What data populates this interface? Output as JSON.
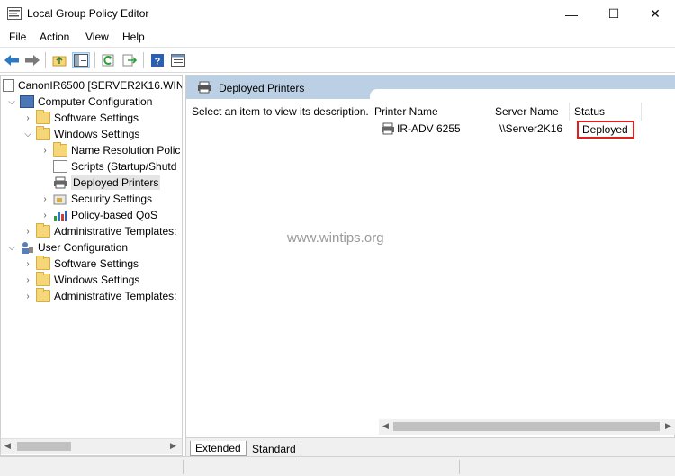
{
  "window": {
    "title": "Local Group Policy Editor",
    "minimize": "—",
    "maximize": "☐",
    "close": "✕"
  },
  "menu": [
    "File",
    "Action",
    "View",
    "Help"
  ],
  "toolbar": {
    "buttons": [
      "back-icon",
      "forward-icon",
      "up-folder-icon",
      "show-hide-tree-icon",
      "refresh-icon",
      "export-list-icon",
      "help-icon",
      "properties-icon"
    ]
  },
  "tree": {
    "root": "CanonIR6500 [SERVER2K16.WINT",
    "computer_config": "Computer Configuration",
    "cc_software": "Software Settings",
    "cc_windows": "Windows Settings",
    "name_resolution": "Name Resolution Polic",
    "scripts": "Scripts (Startup/Shutd",
    "deployed_printers": "Deployed Printers",
    "security": "Security Settings",
    "qos": "Policy-based QoS",
    "cc_admin": "Administrative Templates:",
    "user_config": "User Configuration",
    "uc_software": "Software Settings",
    "uc_windows": "Windows Settings",
    "uc_admin": "Administrative Templates:"
  },
  "right": {
    "header": "Deployed Printers",
    "description": "Select an item to view its description.",
    "columns": [
      "Printer Name",
      "Server Name",
      "Status"
    ],
    "row": {
      "printer": "IR-ADV 6255",
      "server": "\\\\Server2K16",
      "status": "Deployed"
    }
  },
  "watermark": "www.wintips.org",
  "tabs": [
    "Extended",
    "Standard"
  ],
  "colors": {
    "header_blue": "#bcd0e5",
    "highlight_red": "#e0201c",
    "selection": "#e5e5e5"
  }
}
